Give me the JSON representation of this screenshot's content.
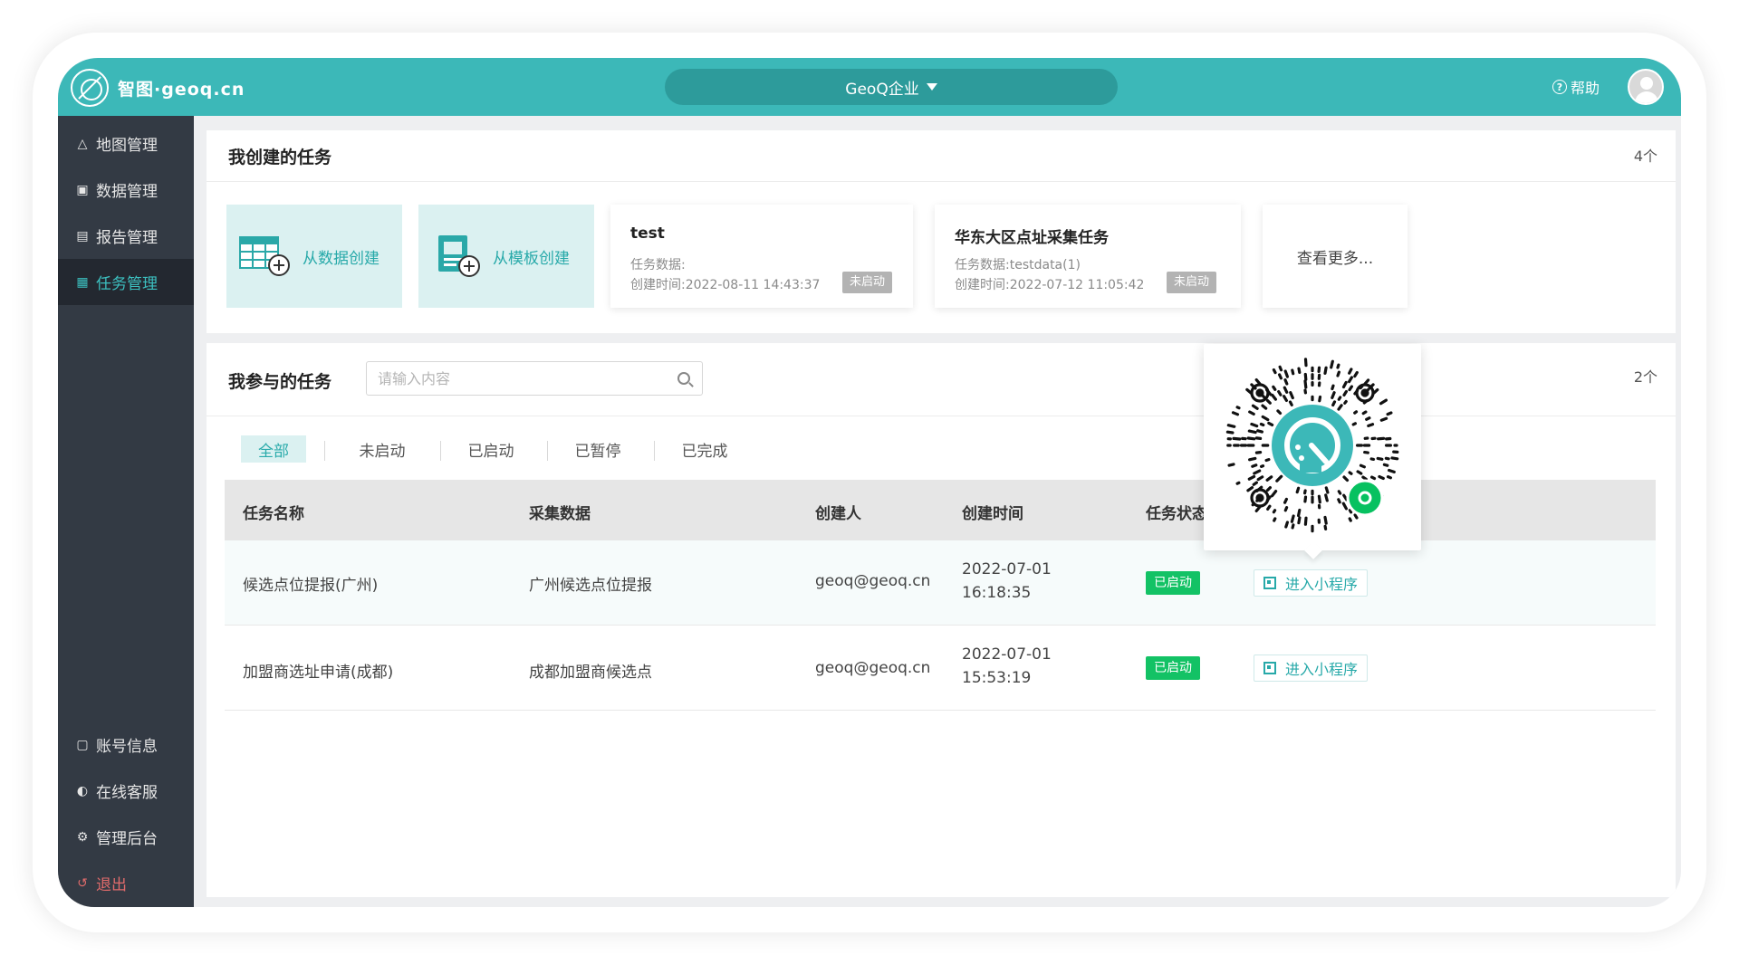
{
  "header": {
    "logo_text": "智图·geoq.cn",
    "org_name": "GeoQ企业",
    "help_label": "帮助"
  },
  "sidebar": {
    "items": [
      {
        "label": "地图管理",
        "icon": "map-icon"
      },
      {
        "label": "数据管理",
        "icon": "database-icon"
      },
      {
        "label": "报告管理",
        "icon": "report-icon"
      },
      {
        "label": "任务管理",
        "icon": "task-icon",
        "active": true
      }
    ],
    "bottom_items": [
      {
        "label": "账号信息",
        "icon": "account-icon"
      },
      {
        "label": "在线客服",
        "icon": "headset-icon"
      },
      {
        "label": "管理后台",
        "icon": "gear-icon"
      },
      {
        "label": "退出",
        "icon": "logout-icon"
      }
    ]
  },
  "created": {
    "title": "我创建的任务",
    "count": "4个",
    "create_from_data": "从数据创建",
    "create_from_template": "从模板创建",
    "tasks": [
      {
        "name": "test",
        "data_label": "任务数据:",
        "data_value": "",
        "time_label": "创建时间:",
        "time_value": "2022-08-11 14:43:37",
        "status": "未启动"
      },
      {
        "name": "华东大区点址采集任务",
        "data_label": "任务数据:",
        "data_value": "testdata(1)",
        "time_label": "创建时间:",
        "time_value": "2022-07-12 11:05:42",
        "status": "未启动"
      }
    ],
    "more": "查看更多..."
  },
  "joined": {
    "title": "我参与的任务",
    "count": "2个",
    "search_placeholder": "请输入内容",
    "tabs": [
      "全部",
      "未启动",
      "已启动",
      "已暂停",
      "已完成"
    ],
    "columns": [
      "任务名称",
      "采集数据",
      "创建人",
      "创建时间",
      "任务状态"
    ],
    "rows": [
      {
        "name": "候选点位提报(广州)",
        "data": "广州候选点位提报",
        "creator": "geoq@geoq.cn",
        "date": "2022-07-01",
        "time": "16:18:35",
        "status": "已启动",
        "action": "进入小程序"
      },
      {
        "name": "加盟商选址申请(成都)",
        "data": "成都加盟商候选点",
        "creator": "geoq@geoq.cn",
        "date": "2022-07-01",
        "time": "15:53:19",
        "status": "已启动",
        "action": "进入小程序"
      }
    ]
  },
  "colors": {
    "accent": "#3cb8b8",
    "sidebar": "#333a44",
    "status_green": "#13c265",
    "status_gray": "#b3b3b3"
  }
}
